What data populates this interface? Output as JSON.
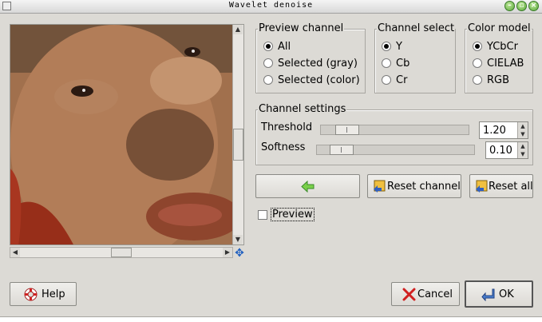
{
  "window": {
    "title": "Wavelet denoise"
  },
  "preview_channel": {
    "title": "Preview channel",
    "options": [
      {
        "label": "All",
        "selected": true
      },
      {
        "label": "Selected (gray)",
        "selected": false
      },
      {
        "label": "Selected (color)",
        "selected": false
      }
    ]
  },
  "channel_select": {
    "title": "Channel select",
    "options": [
      {
        "label": "Y",
        "selected": true
      },
      {
        "label": "Cb",
        "selected": false
      },
      {
        "label": "Cr",
        "selected": false
      }
    ]
  },
  "color_model": {
    "title": "Color model",
    "options": [
      {
        "label": "YCbCr",
        "selected": true
      },
      {
        "label": "CIELAB",
        "selected": false
      },
      {
        "label": "RGB",
        "selected": false
      }
    ]
  },
  "channel_settings": {
    "title": "Channel settings",
    "threshold": {
      "label": "Threshold",
      "value": "1.20"
    },
    "softness": {
      "label": "Softness",
      "value": "0.10"
    }
  },
  "buttons": {
    "reset_channel": "Reset channel",
    "reset_all": "Reset all",
    "help": "Help",
    "cancel": "Cancel",
    "ok": "OK"
  },
  "preview_toggle": {
    "label": "Preview",
    "checked": false
  },
  "icons": {
    "apply_arrow": "arrow-left-green",
    "reset": "reset-yellow",
    "help": "lifebuoy",
    "cancel": "red-x",
    "ok": "return-arrow"
  }
}
